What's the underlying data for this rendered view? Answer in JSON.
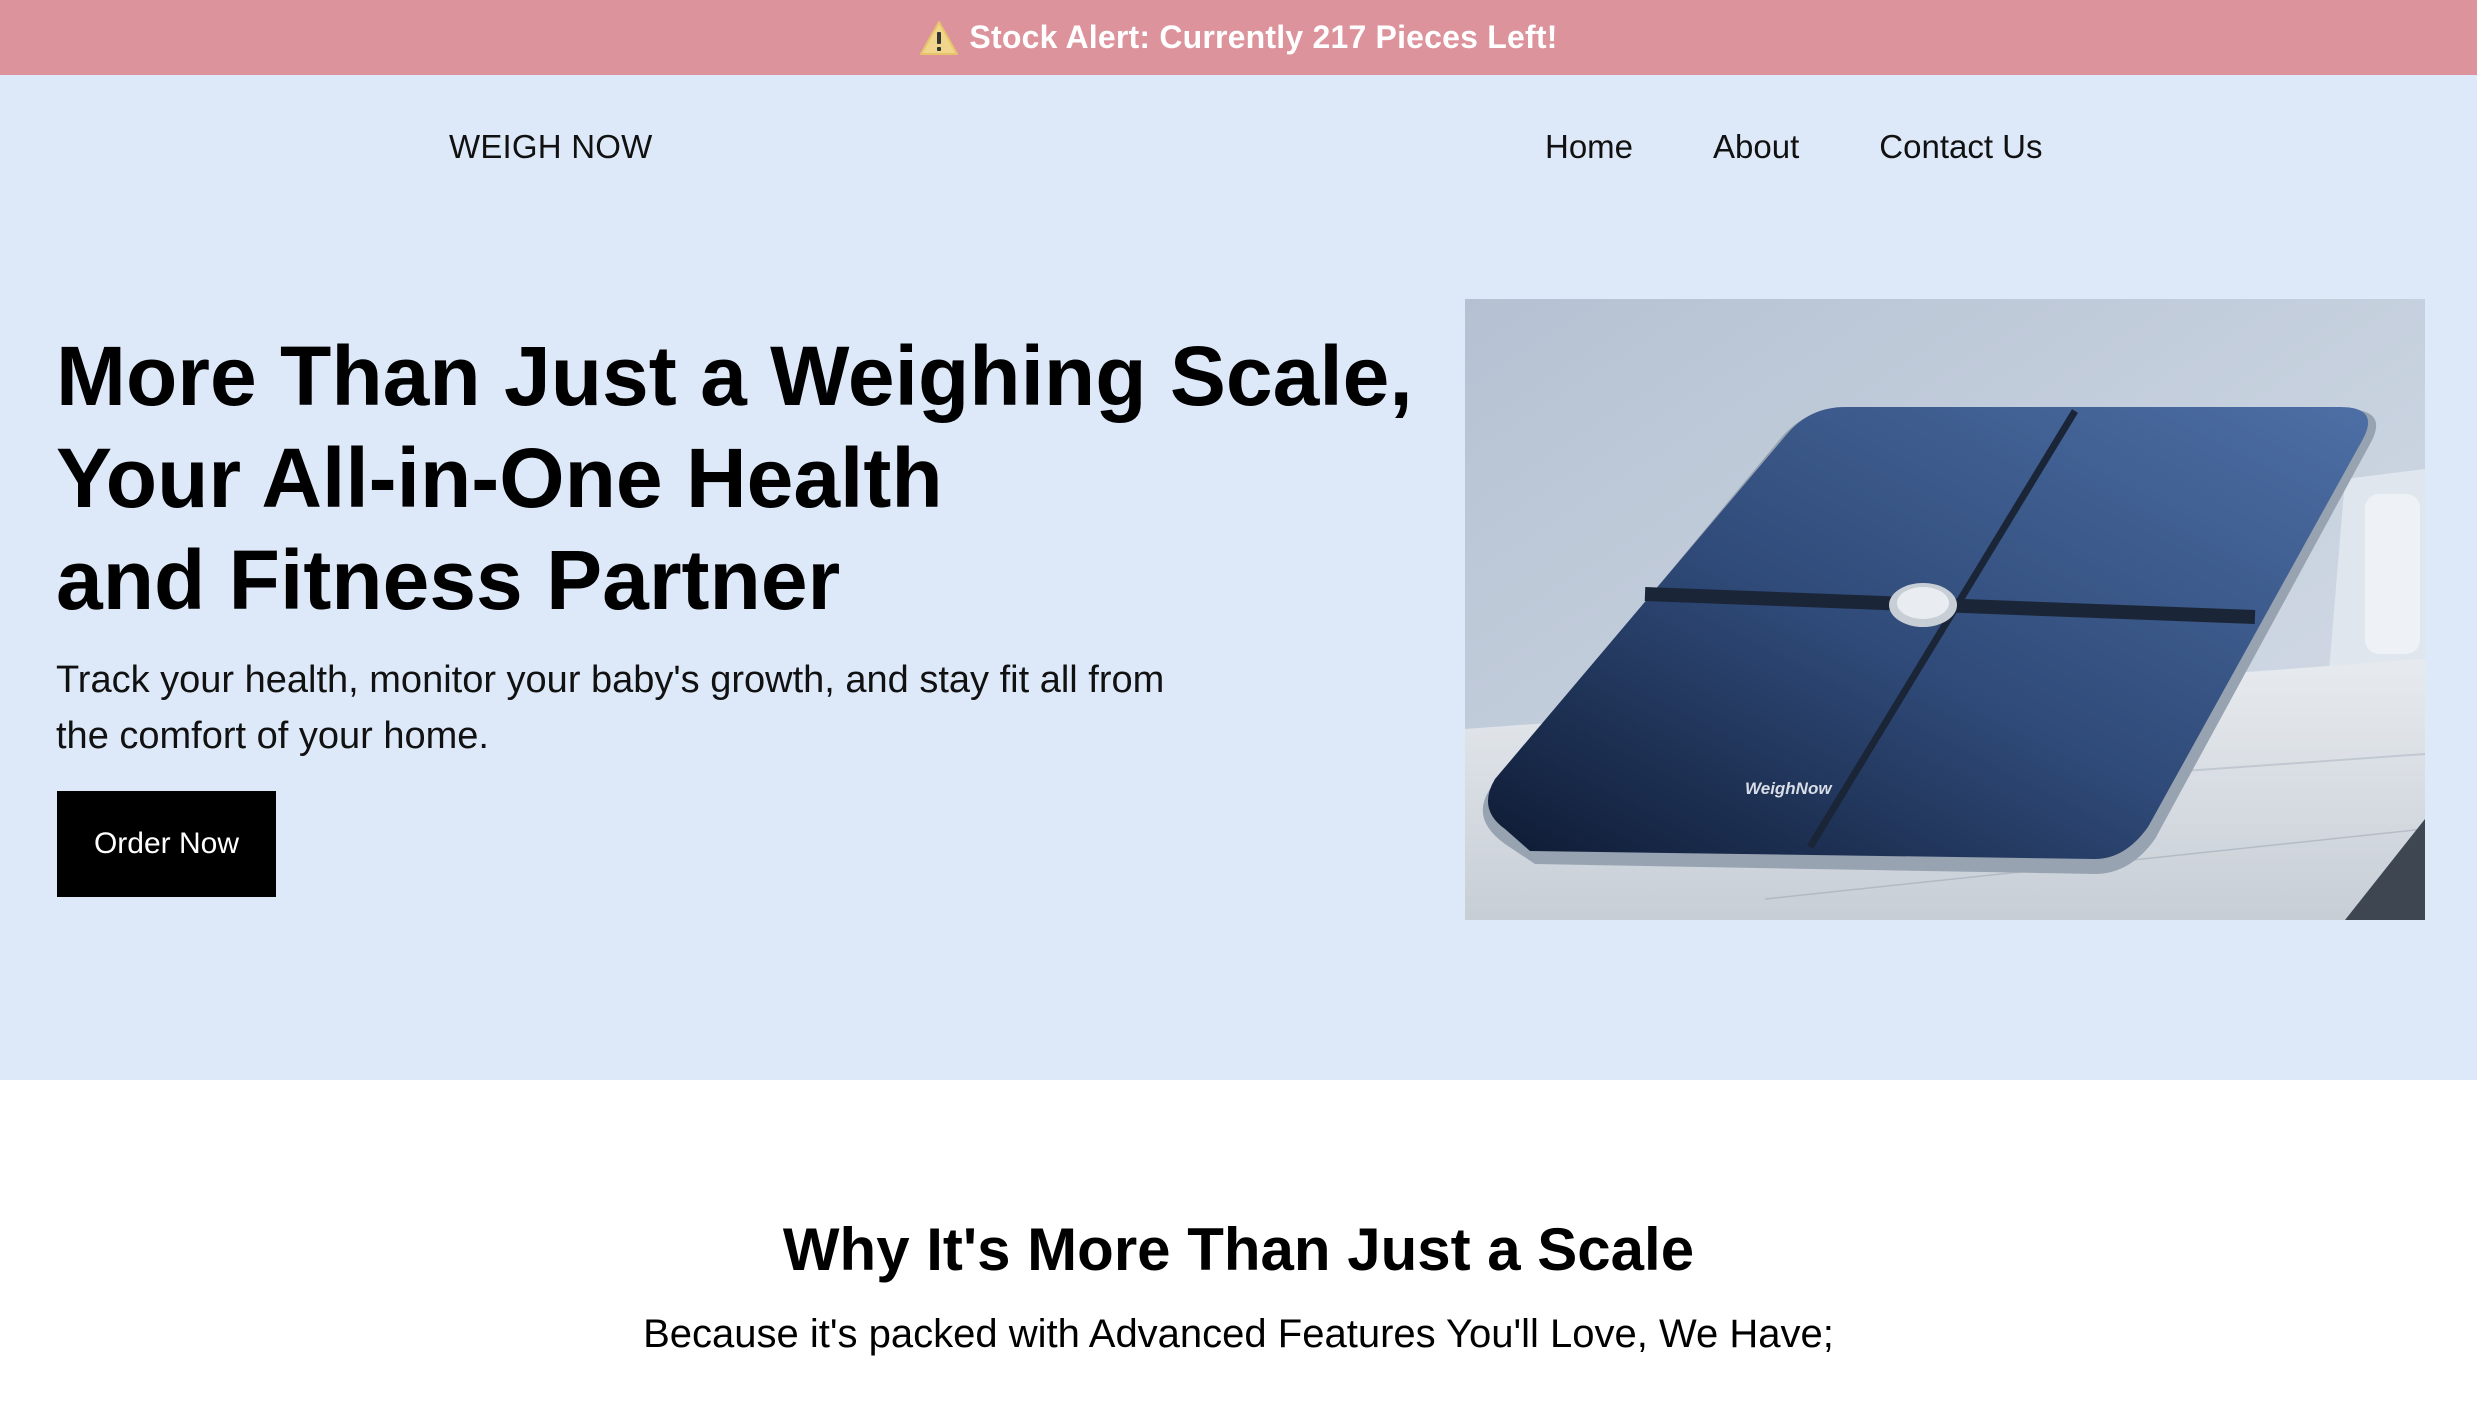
{
  "alert": {
    "text": "Stock Alert: Currently 217 Pieces Left!",
    "icon": "warning-icon",
    "bg_color": "#dc939c"
  },
  "header": {
    "logo": "WEIGH NOW",
    "nav": [
      {
        "label": "Home"
      },
      {
        "label": "About"
      },
      {
        "label": "Contact Us"
      }
    ]
  },
  "hero": {
    "title_lines": [
      "More Than Just a Weighing Scale,",
      "Your All-in-One Health",
      "and Fitness Partner"
    ],
    "subtitle": "Track your health, monitor your baby's growth, and stay fit all from the comfort of your home.",
    "cta_label": "Order Now",
    "bg_color": "#dde9f9",
    "image": {
      "brand_text": "WeighNow"
    }
  },
  "features": {
    "title": "Why It's More Than Just a Scale",
    "subtitle": "Because it's packed with Advanced Features You'll Love, We Have;"
  }
}
